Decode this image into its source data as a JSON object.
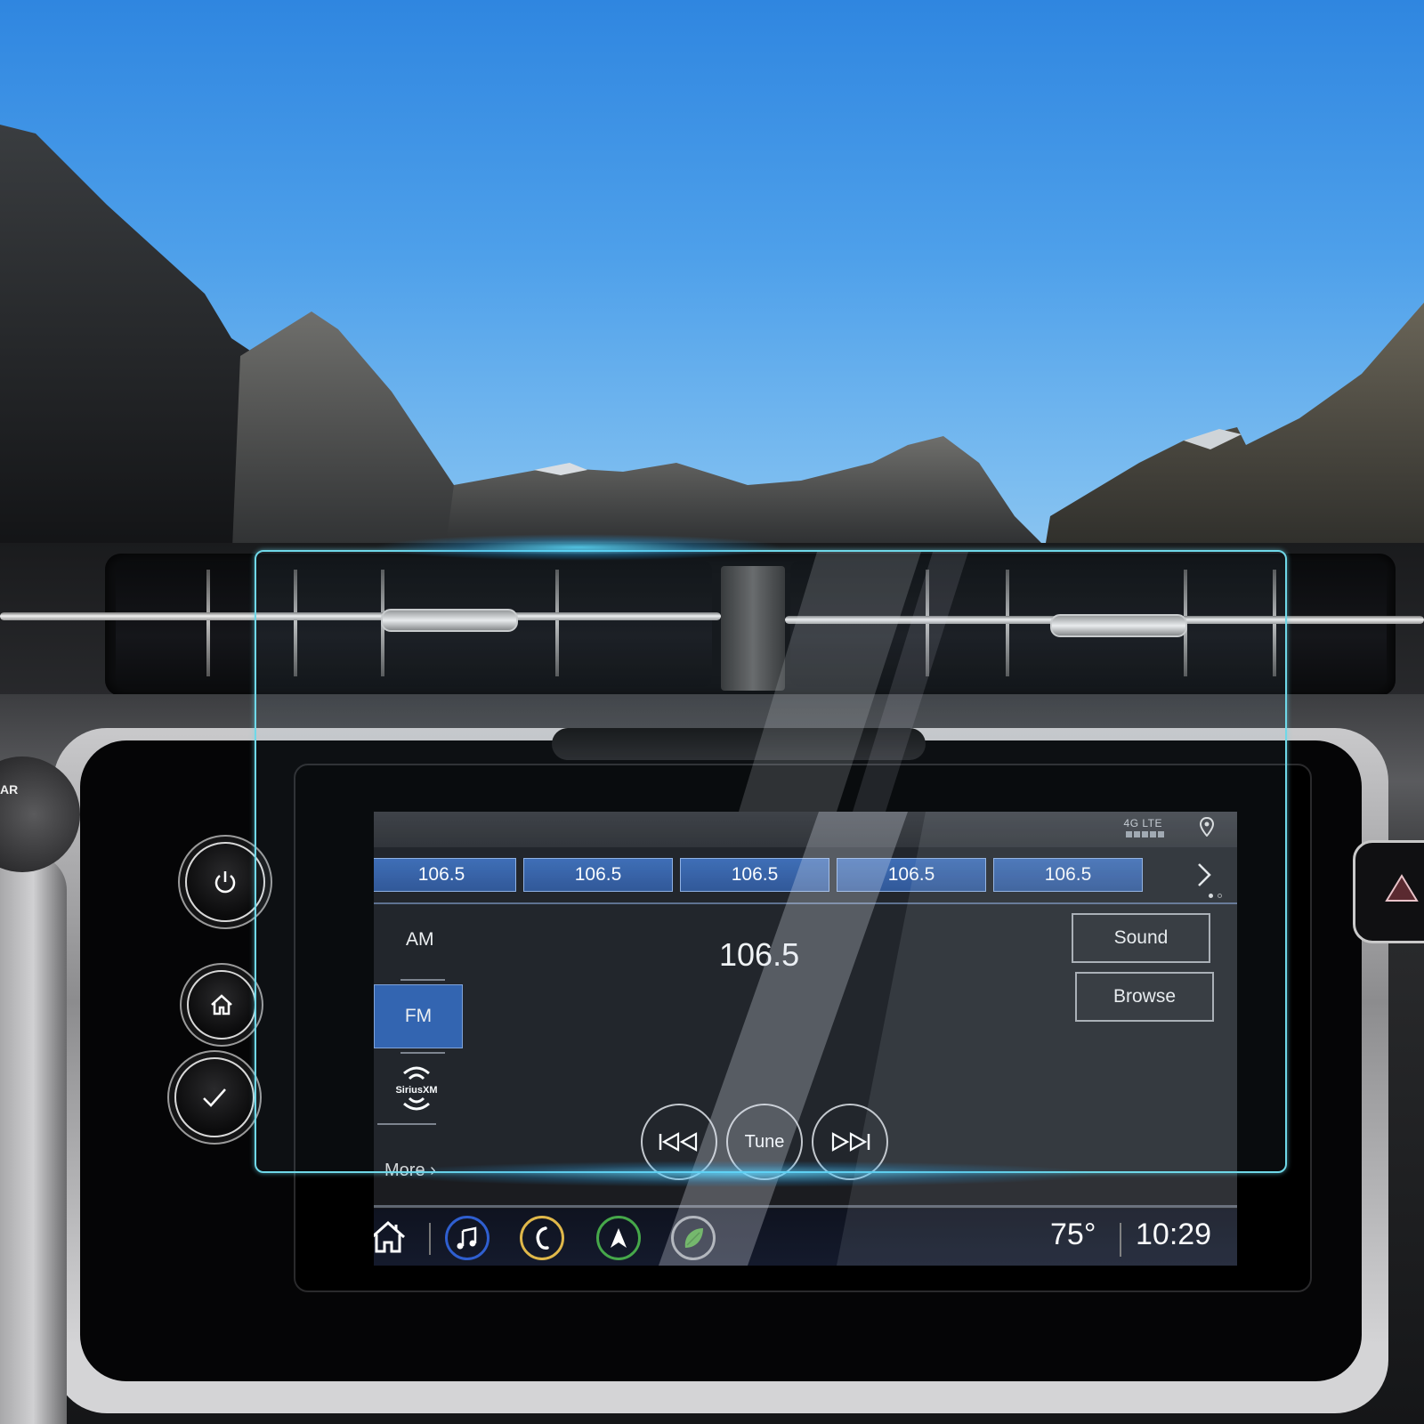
{
  "scene": {
    "description": "Car infotainment screen with a transparent screen-protector film overlay, mountain sky background"
  },
  "status_bar": {
    "network_label": "4G LTE",
    "signal_bars": 5,
    "location_icon": "map-pin-icon"
  },
  "presets": {
    "items": [
      {
        "label": "106.5"
      },
      {
        "label": "106.5"
      },
      {
        "label": "106.5"
      },
      {
        "label": "106.5"
      },
      {
        "label": "106.5"
      }
    ],
    "next_icon": "chevron-right-icon",
    "page_count": 2,
    "current_page": 1
  },
  "bands": {
    "am_label": "AM",
    "fm_label": "FM",
    "selected": "FM",
    "sirius_label": "SiriusXM",
    "more_label": "More ›"
  },
  "now_playing": {
    "frequency": "106.5"
  },
  "side_buttons": {
    "sound_label": "Sound",
    "browse_label": "Browse"
  },
  "transport": {
    "prev_icon": "seek-back-icon",
    "tune_label": "Tune",
    "next_icon": "seek-forward-icon"
  },
  "taskbar": {
    "home_icon": "home-icon",
    "apps": [
      {
        "name": "audio",
        "icon": "music-note-icon",
        "color": "#2f5fd0"
      },
      {
        "name": "phone",
        "icon": "phone-icon",
        "color": "#e0b84a"
      },
      {
        "name": "navigation",
        "icon": "navigation-arrow-icon",
        "color": "#46a84a"
      },
      {
        "name": "energy",
        "icon": "leaf-icon",
        "color": "#a0a4aa"
      }
    ],
    "temperature": "75°",
    "clock": "10:29"
  },
  "hardware": {
    "power_icon": "power-icon",
    "home_icon": "home-icon",
    "check_icon": "check-icon",
    "hazard_icon": "hazard-triangle-icon",
    "stalk_label": "AR"
  },
  "colors": {
    "preset_blue": "#2f5fa8",
    "selected_band": "#2d5fae",
    "film_edge": "#6fd8e8",
    "sky_top": "#2f86e0"
  }
}
